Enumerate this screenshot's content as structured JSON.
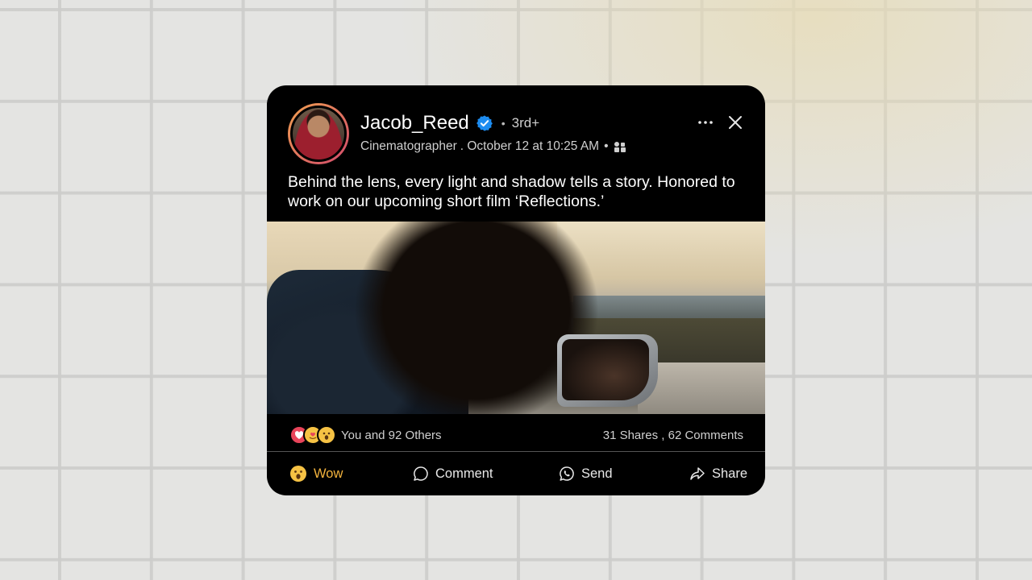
{
  "post": {
    "author": "Jacob_Reed",
    "connection_degree": "3rd+",
    "separator_dot": "•",
    "headline": "Cinematographer",
    "timestamp": ". October 12 at 10:25 AM",
    "audience_separator": "•",
    "text": "Behind the lens, every light and shadow tells a story. Honored to work on our upcoming short film ‘Reflections.’"
  },
  "engagement": {
    "reactions_text": "You and 92 Others",
    "stats_text": "31 Shares , 62 Comments",
    "reaction_icons": [
      "heart-reaction",
      "love-reaction",
      "wow-reaction"
    ]
  },
  "actions": {
    "wow": "Wow",
    "comment": "Comment",
    "send": "Send",
    "share": "Share"
  },
  "colors": {
    "card_bg": "#000000",
    "verified_blue": "#1d8cf0",
    "wow_active": "#f3b33d",
    "avatar_ring_start": "#f0a050",
    "avatar_ring_end": "#d24a6c"
  }
}
